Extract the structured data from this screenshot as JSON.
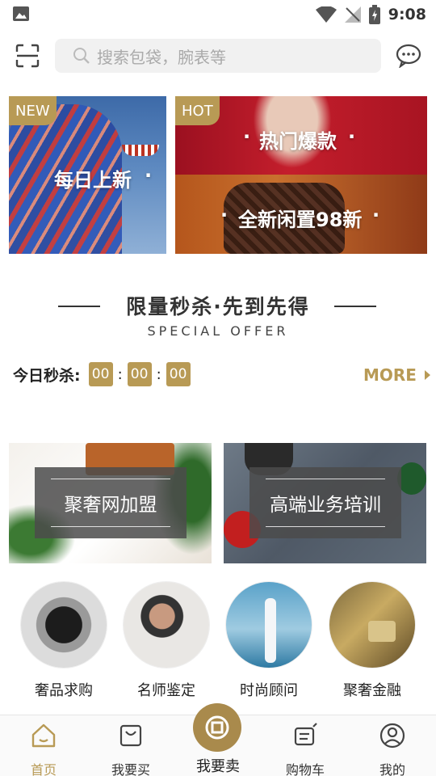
{
  "status_bar": {
    "time": "9:08"
  },
  "search": {
    "placeholder": "搜索包袋，腕表等"
  },
  "banners": {
    "new": {
      "tag": "NEW",
      "label": "每日上新",
      "dot": "·"
    },
    "hot": {
      "tag": "HOT",
      "label": "热门爆款",
      "dot": "·"
    },
    "new98": {
      "label": "全新闲置98新",
      "dot": "·"
    }
  },
  "section": {
    "title": "限量秒杀·先到先得",
    "subtitle": "SPECIAL OFFER"
  },
  "countdown": {
    "label": "今日秒杀:",
    "hours": "00",
    "minutes": "00",
    "seconds": "00",
    "more": "MORE"
  },
  "promos": [
    {
      "label": "聚奢网加盟"
    },
    {
      "label": "高端业务培训"
    }
  ],
  "categories": [
    {
      "name": "奢品求购"
    },
    {
      "name": "名师鉴定"
    },
    {
      "name": "时尚顾问"
    },
    {
      "name": "聚奢金融"
    }
  ],
  "nav": [
    {
      "label": "首页",
      "icon": "home-icon"
    },
    {
      "label": "我要买",
      "icon": "buy-icon"
    },
    {
      "label": "我要卖",
      "icon": "sell-icon"
    },
    {
      "label": "购物车",
      "icon": "cart-icon"
    },
    {
      "label": "我的",
      "icon": "profile-icon"
    }
  ],
  "colors": {
    "accent": "#b89a55",
    "sell_button": "#a98a4c"
  }
}
